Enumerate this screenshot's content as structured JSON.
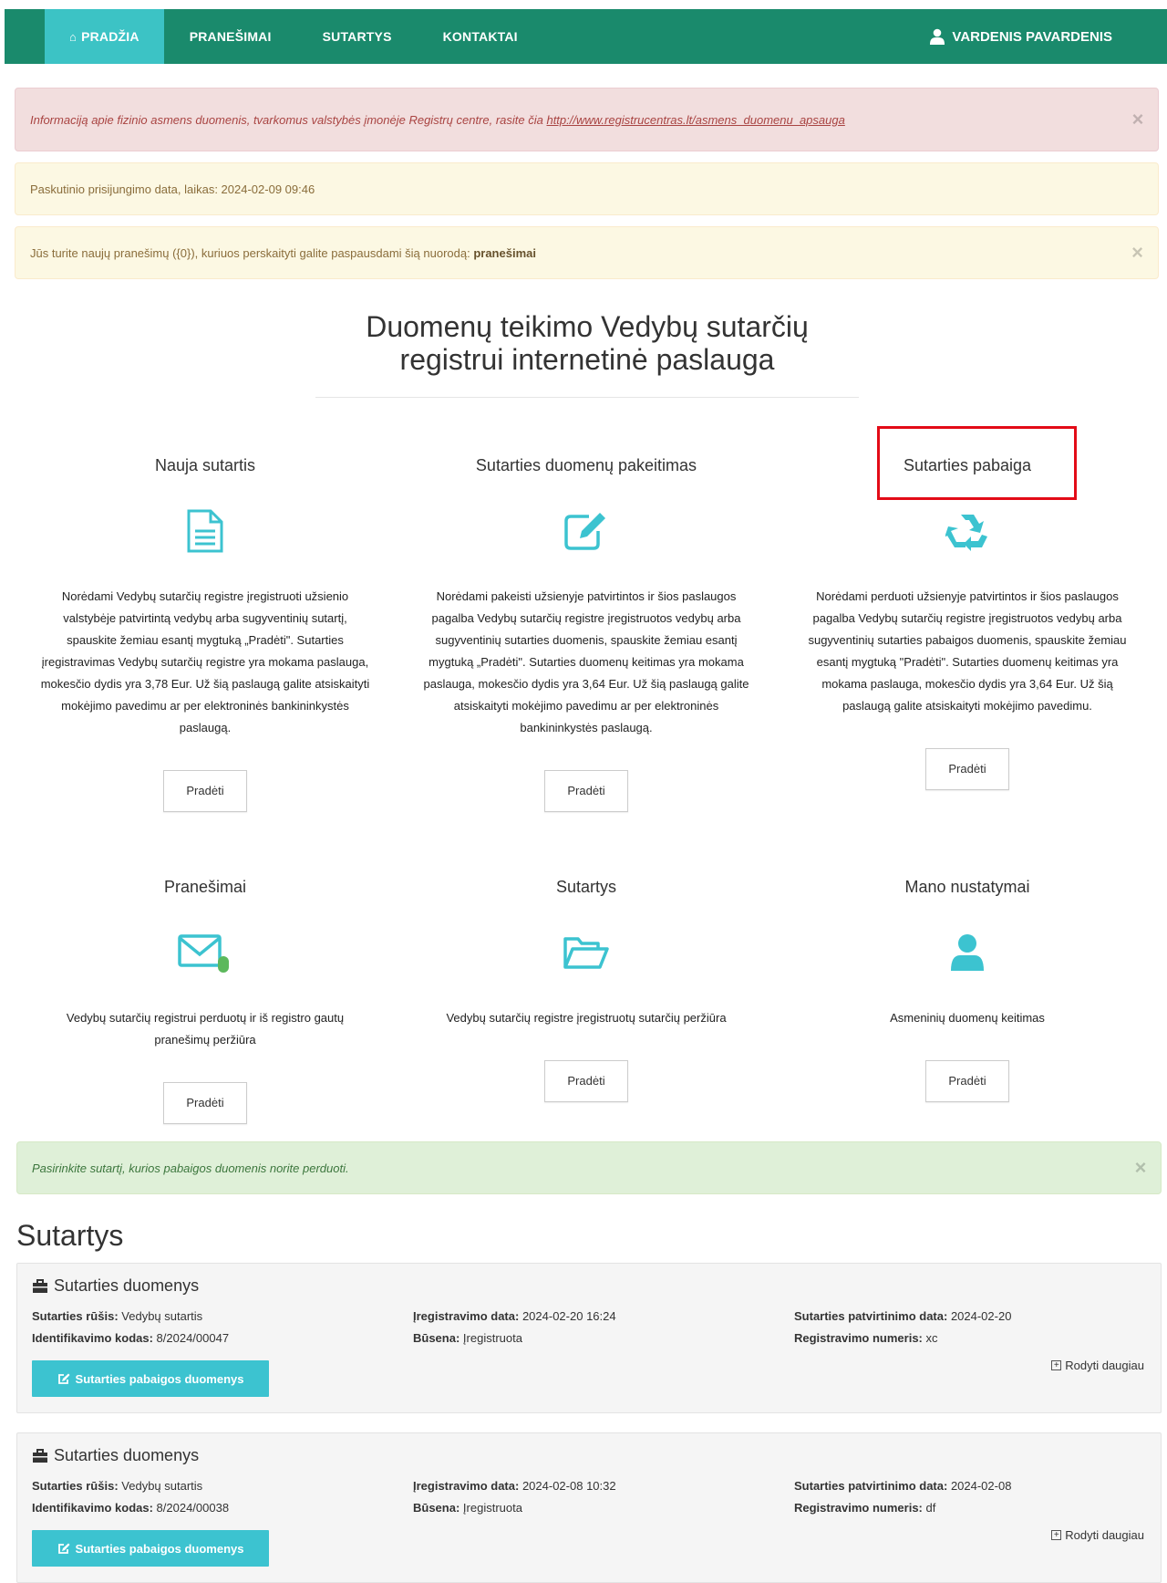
{
  "nav": {
    "items": [
      {
        "label": "PRADŽIA",
        "icon": "home-icon",
        "active": true
      },
      {
        "label": "PRANEŠIMAI"
      },
      {
        "label": "SUTARTYS"
      },
      {
        "label": "KONTAKTAI"
      }
    ],
    "user": {
      "label": "VARDENIS PAVARDENIS",
      "icon": "user-icon"
    }
  },
  "alerts": {
    "privacy": {
      "text": "Informaciją apie fizinio asmens duomenis, tvarkomus valstybės įmonėje Registrų centre, rasite čia ",
      "link": "http://www.registrucentras.lt/asmens_duomenu_apsauga"
    },
    "last_login": {
      "text": "Paskutinio prisijungimo data, laikas: 2024-02-09 09:46"
    },
    "messages": {
      "text": "Jūs turite naujų pranešimų ({0}), kuriuos perskaityti galite paspausdami šią nuorodą: ",
      "link": "pranešimai"
    },
    "choose": {
      "text": "Pasirinkite sutartį, kurios pabaigos duomenis norite perduoti."
    },
    "close_glyph": "×"
  },
  "main": {
    "title_line1": "Duomenų teikimo Vedybų sutarčių",
    "title_line2": "registrui internetinė paslauga"
  },
  "cards": [
    {
      "title": "Nauja sutartis",
      "icon": "document-icon",
      "desc": "Norėdami Vedybų sutarčių registre įregistruoti užsienio valstybėje patvirtintą vedybų arba sugyventinių sutartį, spauskite žemiau esantį mygtuką „Pradėti\". Sutarties įregistravimas Vedybų sutarčių registre yra mokama paslauga, mokesčio dydis yra 3,78 Eur. Už šią paslaugą galite atsiskaityti mokėjimo pavedimu ar per elektroninės bankininkystės paslaugą.",
      "button": "Pradėti"
    },
    {
      "title": "Sutarties duomenų pakeitimas",
      "icon": "edit-icon",
      "desc": "Norėdami pakeisti užsienyje patvirtintos ir šios paslaugos pagalba Vedybų sutarčių registre įregistruotos vedybų arba sugyventinių sutarties duomenis, spauskite žemiau esantį mygtuką „Pradėti\". Sutarties duomenų keitimas yra mokama paslauga, mokesčio dydis yra 3,64 Eur. Už šią paslaugą galite atsiskaityti mokėjimo pavedimu ar per elektroninės bankininkystės paslaugą.",
      "button": "Pradėti"
    },
    {
      "title": "Sutarties pabaiga",
      "icon": "recycle-icon",
      "desc": "Norėdami perduoti užsienyje patvirtintos ir šios paslaugos pagalba Vedybų sutarčių registre įregistruotos vedybų arba sugyventinių sutarties pabaigos duomenis, spauskite žemiau esantį mygtuką \"Pradėti\". Sutarties duomenų keitimas yra mokama paslauga, mokesčio dydis yra 3,64 Eur. Už šią paslaugą galite atsiskaityti mokėjimo pavedimu.",
      "button": "Pradėti"
    },
    {
      "title": "Pranešimai",
      "icon": "envelope-icon",
      "desc": "Vedybų sutarčių registrui perduotų ir iš registro gautų pranešimų peržiūra",
      "button": "Pradėti"
    },
    {
      "title": "Sutartys",
      "icon": "folder-open-icon",
      "desc": "Vedybų sutarčių registre įregistruotų sutarčių peržiūra",
      "button": "Pradėti"
    },
    {
      "title": "Mano nustatymai",
      "icon": "user-icon",
      "desc": "Asmeninių duomenų keitimas",
      "button": "Pradėti"
    }
  ],
  "contracts_section": {
    "title": "Sutartys",
    "labels": {
      "header": "Sutarties duomenys",
      "type": "Sutarties rūšis:",
      "id": "Identifikavimo kodas:",
      "reg_date": "Įregistravimo data:",
      "status": "Būsena:",
      "approve_date": "Sutarties patvirtinimo data:",
      "reg_number": "Registravimo numeris:",
      "more": "Rodyti daugiau",
      "button": "Sutarties pabaigos duomenys"
    },
    "items": [
      {
        "type": "Vedybų sutartis",
        "id": "8/2024/00047",
        "reg_date": "2024-02-20 16:24",
        "status": "Įregistruota",
        "approve_date": "2024-02-20",
        "reg_number": "xc"
      },
      {
        "type": "Vedybų sutartis",
        "id": "8/2024/00038",
        "reg_date": "2024-02-08 10:32",
        "status": "Įregistruota",
        "approve_date": "2024-02-08",
        "reg_number": "df"
      }
    ]
  },
  "colors": {
    "navbar": "#1a8a6c",
    "nav_active": "#3cc3c5",
    "icon": "#3cc3d0",
    "highlight": "#e30b17"
  }
}
